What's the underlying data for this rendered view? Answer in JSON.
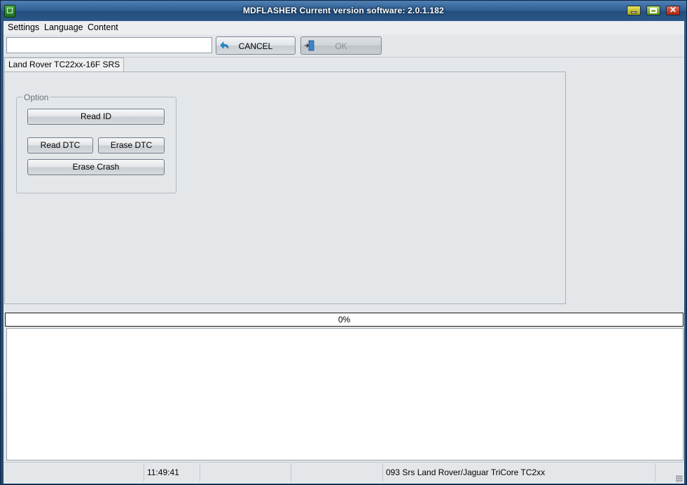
{
  "window": {
    "title": "MDFLASHER  Current version software: 2.0.1.182"
  },
  "menu": {
    "items": [
      "Settings",
      "Language",
      "Content"
    ]
  },
  "toolbar": {
    "search_value": "",
    "cancel_label": "CANCEL",
    "ok_label": "OK",
    "ok_enabled": false
  },
  "tabs": [
    {
      "label": "Land Rover TC22xx-16F SRS",
      "active": true
    }
  ],
  "option_group": {
    "legend": "Option",
    "read_id_label": "Read ID",
    "read_dtc_label": "Read DTC",
    "erase_dtc_label": "Erase DTC",
    "erase_crash_label": "Erase Crash"
  },
  "progress": {
    "value": 0,
    "text": "0%"
  },
  "log": {
    "lines": []
  },
  "statusbar": {
    "cell1": "",
    "time": "11:49:41",
    "cell3": "",
    "module": "093 Srs Land Rover/Jaguar TriCore TC2xx",
    "cell5": ""
  },
  "colors": {
    "titlebar": "#2e5e92",
    "client_bg": "#e4e7ea",
    "cancel_icon": "#1e8fd6",
    "ok_icon": "#2a6fb3"
  },
  "icons": {
    "app": "app-icon",
    "cancel": "undo-arrow-icon",
    "ok": "exit-door-icon"
  }
}
